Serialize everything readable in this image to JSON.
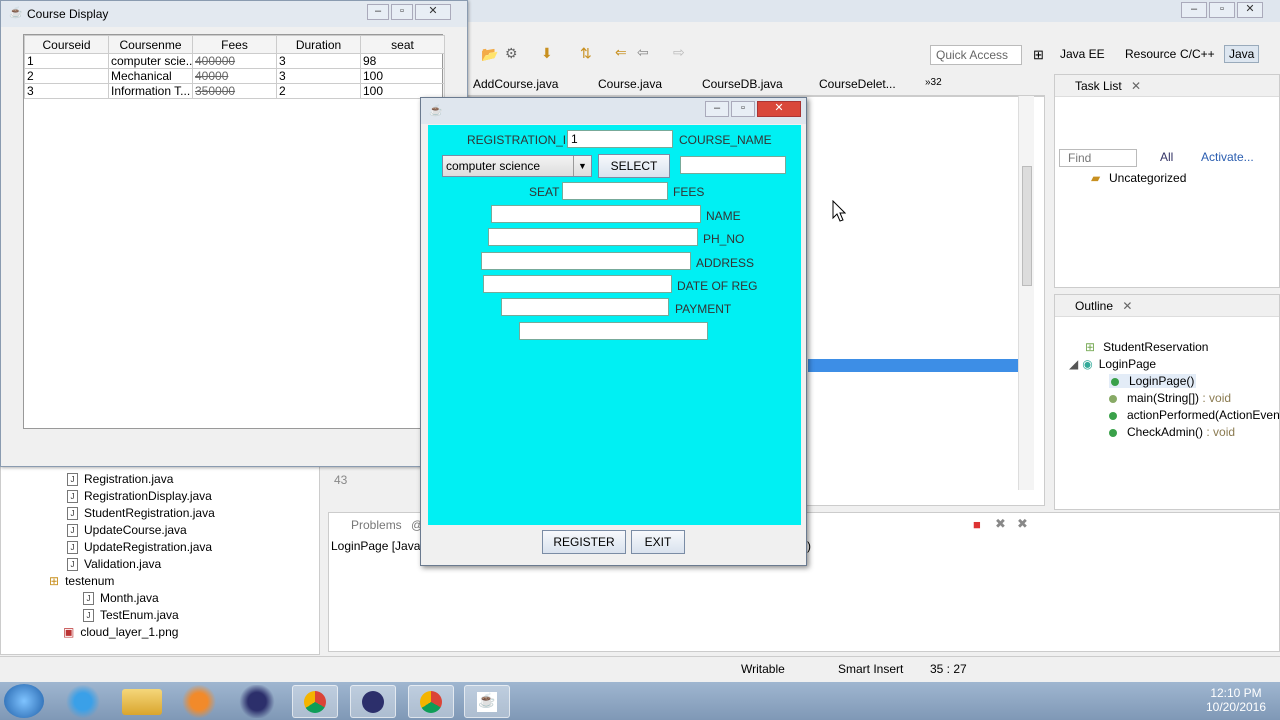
{
  "eclipse": {
    "quick_access": "Quick Access",
    "perspectives": [
      "Java EE",
      "Resource",
      "C/C++",
      "Java"
    ],
    "editor_tabs": [
      "AddCourse.java",
      "Course.java",
      "CourseDB.java",
      "CourseDelet..."
    ],
    "more_tabs": "»32",
    "line_number": "43",
    "task_list": {
      "title": "Task List",
      "find_placeholder": "Find",
      "all": "All",
      "activate": "Activate...",
      "category": "Uncategorized"
    },
    "outline": {
      "title": "Outline",
      "items": [
        {
          "label": "StudentReservation",
          "suffix": ""
        },
        {
          "label": "LoginPage",
          "suffix": ""
        },
        {
          "label": "LoginPage()",
          "suffix": ""
        },
        {
          "label": "main(String[])",
          "suffix": " : void"
        },
        {
          "label": "actionPerformed(ActionEvent",
          "suffix": ""
        },
        {
          "label": "CheckAdmin()",
          "suffix": " : void"
        }
      ]
    },
    "package_explorer": {
      "files": [
        "Registration.java",
        "RegistrationDisplay.java",
        "StudentRegistration.java",
        "UpdateCourse.java",
        "UpdateRegistration.java",
        "Validation.java"
      ],
      "package": "testenum",
      "pkg_files": [
        "Month.java",
        "TestEnum.java"
      ],
      "image": "cloud_layer_1.png"
    },
    "console": {
      "tab": "Problems",
      "at": "@",
      "line": "LoginPage [Java A",
      "paren": ")"
    },
    "status": {
      "writable": "Writable",
      "insert": "Smart Insert",
      "position": "35 : 27"
    }
  },
  "course_display": {
    "title": "Course Display",
    "columns": [
      "Courseid",
      "Coursenme",
      "Fees",
      "Duration",
      "seat"
    ],
    "rows": [
      [
        "1",
        "computer scie...",
        "400000",
        "3",
        "98"
      ],
      [
        "2",
        "Mechanical",
        "40000",
        "3",
        "100"
      ],
      [
        "3",
        "Information T...",
        "350000",
        "2",
        "100"
      ]
    ]
  },
  "registration": {
    "labels": {
      "registration_id": "REGISTRATION_ID",
      "course_name": "COURSE_NAME",
      "seat": "SEAT",
      "fees": "FEES",
      "name": "NAME",
      "ph_no": "PH_NO",
      "address": "ADDRESS",
      "date_of_reg": "DATE OF REG",
      "payment": "PAYMENT"
    },
    "registration_id_value": "1",
    "course_select": "computer science",
    "select_button": "SELECT",
    "register_button": "REGISTER",
    "exit_button": "EXIT"
  },
  "taskbar": {
    "time": "12:10 PM",
    "date": "10/20/2016"
  }
}
